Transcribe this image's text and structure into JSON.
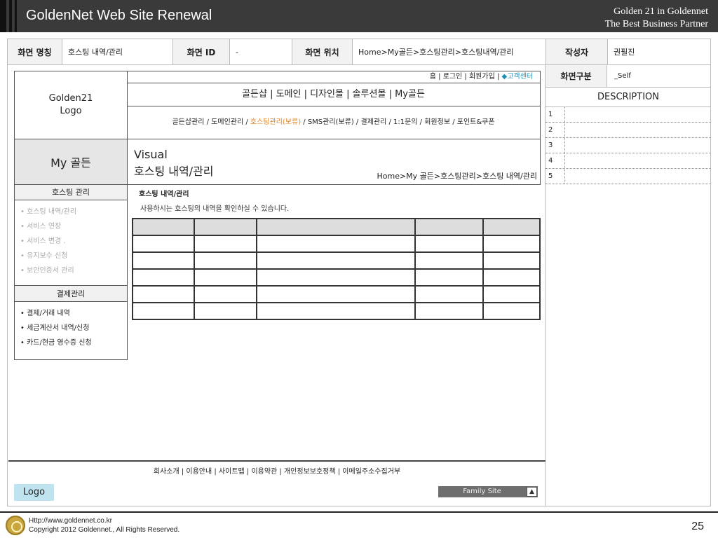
{
  "header": {
    "title": "GoldenNet Web Site Renewal",
    "subtitle_line1": "Golden 21 in Goldennet",
    "subtitle_line2": "The Best Business Partner"
  },
  "info": {
    "screen_name_label": "화면 명칭",
    "screen_name_value": "호스팅 내역/관리",
    "screen_id_label": "화면 ID",
    "screen_id_value": "-",
    "screen_pos_label": "화면 위치",
    "screen_pos_value": "Home>My골든>호스팅관리>호스팅내역/관리",
    "author_label": "작성자",
    "author_value": "권필진"
  },
  "wireframe": {
    "logo_line1": "Golden21",
    "logo_line2": "Logo",
    "util_links": "홈 | 로그인 | 회원가입 | ",
    "util_cs": "◆고객센터",
    "gnb": "골든샵 | 도메인 | 디자인몰 | 솔루션몰 | My골든",
    "lnb_before": "골든샵관리 / 도메인관리 / ",
    "lnb_active": "호스팅관리(보류)",
    "lnb_after": " / SMS관리(보류) / 결제관리 / 1:1문의 / 회원정보 / 포인트&쿠폰",
    "my_gold": "My 골든",
    "visual_title": "Visual",
    "visual_subtitle": "호스팅 내역/관리",
    "breadcrumb": "Home>My 골든>호스팅관리>호스팅 내역/관리",
    "side_head1": "호스팅 관리",
    "side_menu1": [
      "• 호스팅 내역/관리",
      "• 서비스 연장",
      "• 서비스 변경 .",
      "• 유지보수 신청",
      "• 보안인증서 관리"
    ],
    "side_head2": "결제관리",
    "side_menu2": [
      "• 결제/거래 내역",
      "• 세금계산서 내역/신청",
      "• 카드/현금 영수증 신청"
    ],
    "content_title": "호스팅 내역/관리",
    "content_desc": "사용하시는 호스팅의 내역을 확인하실 수 있습니다.",
    "footer_links": "회사소개 | 이용안내 | 사이트맵 | 이용약관 | 개인정보보호정책 | 이메일주소수집거부",
    "footer_logo": "Logo",
    "family_site": "Family Site",
    "family_arrow": "▲"
  },
  "description": {
    "type_label": "화면구분",
    "type_value": "_Self",
    "title": "DESCRIPTION",
    "rows": [
      "1",
      "2",
      "3",
      "4",
      "5"
    ]
  },
  "slide_footer": {
    "url": "Http://www.goldennet.co.kr",
    "copyright": "Copyright 2012 Goldennet., All Rights Reserved.",
    "page": "25"
  },
  "colors": {
    "header_bg": "#3a3a3a",
    "active_menu": "#e8821e",
    "cs_link": "#1a8fb8",
    "logo_bg": "#bfe3ef"
  }
}
